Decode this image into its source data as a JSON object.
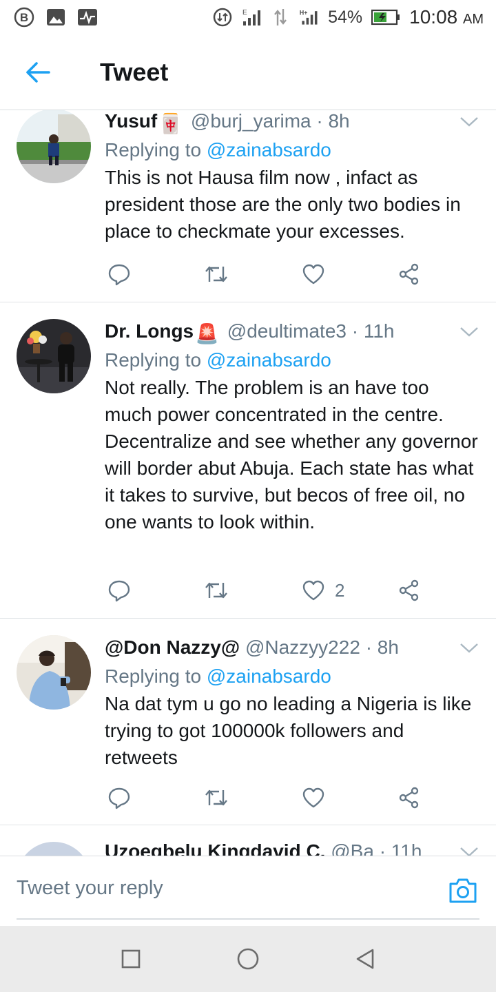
{
  "status_bar": {
    "battery": "54%",
    "time": "10:08",
    "ampm": "AM",
    "net_type": "H+"
  },
  "header": {
    "title": "Tweet",
    "back_icon": "back-arrow-icon"
  },
  "colors": {
    "accent": "#1da1f2",
    "secondary_text": "#657786",
    "primary_text": "#14171a",
    "divider": "#dfe3e6"
  },
  "tweets": [
    {
      "name": "Yusuf",
      "emoji": "🀄",
      "handle": "@burj_yarima",
      "time": "· 8h",
      "replying_prefix": "Replying to",
      "replying_to": "@zainabsardo",
      "text": "This is not Hausa film now , infact as president those are the only two bodies in place to checkmate your excesses.",
      "like_count": ""
    },
    {
      "name": "Dr. Longs",
      "emoji": "🚨",
      "handle": "@deultimate3",
      "time": "· 11h",
      "replying_prefix": "Replying to",
      "replying_to": "@zainabsardo",
      "text": "Not really. The problem is an have too much power concentrated in the centre. Decentralize and see whether any governor will border abut Abuja. Each state has what it takes to survive, but becos of free oil, no one wants to look within.",
      "like_count": "2"
    },
    {
      "name": "@Don Nazzy@",
      "emoji": "",
      "handle": "@Nazzyy222",
      "time": "· 8h",
      "replying_prefix": "Replying to",
      "replying_to": "@zainabsardo",
      "text": "Na dat tym u go no leading a Nigeria is like trying to got 100000k followers and retweets",
      "like_count": ""
    },
    {
      "name": "Uzoegbelu Kingdavid C.",
      "emoji": "",
      "handle": "@Ba",
      "time": "· 11h",
      "replying_prefix": "",
      "replying_to": "",
      "text": "",
      "like_count": ""
    }
  ],
  "reply_bar": {
    "placeholder": "Tweet your reply",
    "camera_icon": "camera-icon"
  },
  "nav_bar": {
    "icons": [
      "recents-square-icon",
      "home-circle-icon",
      "back-triangle-icon"
    ]
  }
}
